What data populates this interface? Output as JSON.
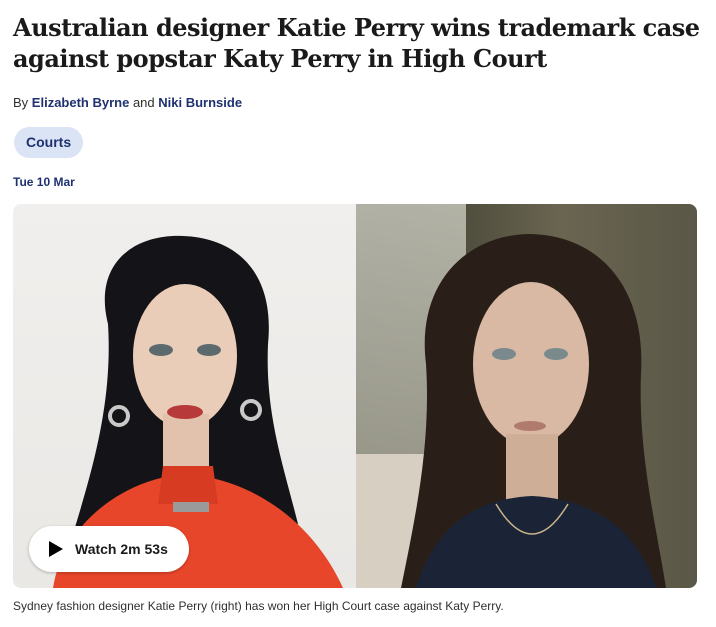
{
  "article": {
    "headline": "Australian designer Katie Perry wins trademark case against popstar Katy Perry in High Court",
    "byline": {
      "prefix": "By ",
      "author_1": "Elizabeth Byrne",
      "conjunction": " and ",
      "author_2": "Niki Burnside"
    },
    "topic_tag": "Courts",
    "date": "Tue 10 Mar",
    "media": {
      "play_icon": "play-icon",
      "watch_label": "Watch 2m 53s",
      "caption": "Sydney fashion designer Katie Perry (right) has won her High Court case against Katy Perry."
    }
  },
  "colors": {
    "link": "#1f3170",
    "tag_background": "#dbe4f5",
    "text": "#1a1a1a"
  }
}
